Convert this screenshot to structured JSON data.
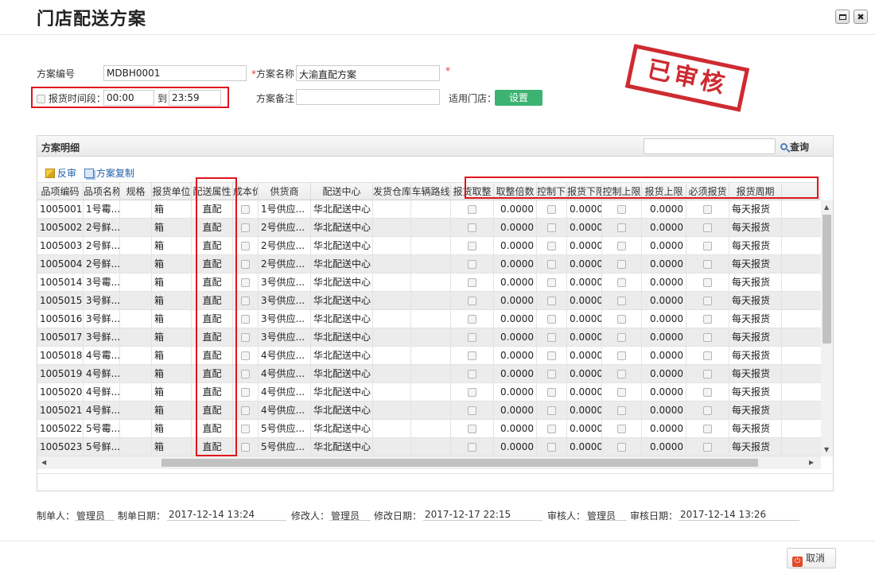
{
  "window": {
    "title": "门店配送方案",
    "max_glyph": "□",
    "close_glyph": "✖"
  },
  "form": {
    "code_label": "方案编号",
    "code_value": "MDBH0001",
    "name_required": "*",
    "name_label": "方案名称",
    "name_value": "大渝直配方案",
    "name_required_tail": "*",
    "time_label": "报货时间段：",
    "time_from": "00:00",
    "time_to_label": "到",
    "time_to": "23:59",
    "remark_label": "方案备注",
    "remark_value": "",
    "store_label": "适用门店：",
    "store_button": "设置"
  },
  "stamp": {
    "text": "已审核"
  },
  "panel": {
    "title": "方案明细",
    "search_value": "",
    "query_label": "查询",
    "toolbar": {
      "reverse_label": "反审",
      "copy_label": "方案复制"
    }
  },
  "columns": [
    "品项编码",
    "品项名称",
    "规格",
    "报货单位",
    "配送属性",
    "成本价",
    "供货商",
    "配送中心",
    "发货仓库",
    "车辆路线",
    "报货取整",
    "取整倍数",
    "控制下限",
    "报货下限",
    "控制上限",
    "报货上限",
    "必须报货",
    "报货周期"
  ],
  "rows": [
    {
      "code": "1005001",
      "name": "1号霉...",
      "spec": "",
      "unit": "箱",
      "attr": "直配",
      "supplier": "1号供应...",
      "center": "华北配送中心",
      "multiple": "0.0000",
      "lower": "0.0000",
      "upper": "0.0000",
      "cycle": "每天报货"
    },
    {
      "code": "1005002",
      "name": "2号鲜...",
      "spec": "",
      "unit": "箱",
      "attr": "直配",
      "supplier": "2号供应...",
      "center": "华北配送中心",
      "multiple": "0.0000",
      "lower": "0.0000",
      "upper": "0.0000",
      "cycle": "每天报货"
    },
    {
      "code": "1005003",
      "name": "2号鲜...",
      "spec": "",
      "unit": "箱",
      "attr": "直配",
      "supplier": "2号供应...",
      "center": "华北配送中心",
      "multiple": "0.0000",
      "lower": "0.0000",
      "upper": "0.0000",
      "cycle": "每天报货"
    },
    {
      "code": "1005004",
      "name": "2号鲜...",
      "spec": "",
      "unit": "箱",
      "attr": "直配",
      "supplier": "2号供应...",
      "center": "华北配送中心",
      "multiple": "0.0000",
      "lower": "0.0000",
      "upper": "0.0000",
      "cycle": "每天报货"
    },
    {
      "code": "1005014",
      "name": "3号霉...",
      "spec": "",
      "unit": "箱",
      "attr": "直配",
      "supplier": "3号供应...",
      "center": "华北配送中心",
      "multiple": "0.0000",
      "lower": "0.0000",
      "upper": "0.0000",
      "cycle": "每天报货"
    },
    {
      "code": "1005015",
      "name": "3号鲜...",
      "spec": "",
      "unit": "箱",
      "attr": "直配",
      "supplier": "3号供应...",
      "center": "华北配送中心",
      "multiple": "0.0000",
      "lower": "0.0000",
      "upper": "0.0000",
      "cycle": "每天报货"
    },
    {
      "code": "1005016",
      "name": "3号鲜...",
      "spec": "",
      "unit": "箱",
      "attr": "直配",
      "supplier": "3号供应...",
      "center": "华北配送中心",
      "multiple": "0.0000",
      "lower": "0.0000",
      "upper": "0.0000",
      "cycle": "每天报货"
    },
    {
      "code": "1005017",
      "name": "3号鲜...",
      "spec": "",
      "unit": "箱",
      "attr": "直配",
      "supplier": "3号供应...",
      "center": "华北配送中心",
      "multiple": "0.0000",
      "lower": "0.0000",
      "upper": "0.0000",
      "cycle": "每天报货"
    },
    {
      "code": "1005018",
      "name": "4号霉...",
      "spec": "",
      "unit": "箱",
      "attr": "直配",
      "supplier": "4号供应...",
      "center": "华北配送中心",
      "multiple": "0.0000",
      "lower": "0.0000",
      "upper": "0.0000",
      "cycle": "每天报货"
    },
    {
      "code": "1005019",
      "name": "4号鲜...",
      "spec": "",
      "unit": "箱",
      "attr": "直配",
      "supplier": "4号供应...",
      "center": "华北配送中心",
      "multiple": "0.0000",
      "lower": "0.0000",
      "upper": "0.0000",
      "cycle": "每天报货"
    },
    {
      "code": "1005020",
      "name": "4号鲜...",
      "spec": "",
      "unit": "箱",
      "attr": "直配",
      "supplier": "4号供应...",
      "center": "华北配送中心",
      "multiple": "0.0000",
      "lower": "0.0000",
      "upper": "0.0000",
      "cycle": "每天报货"
    },
    {
      "code": "1005021",
      "name": "4号鲜...",
      "spec": "",
      "unit": "箱",
      "attr": "直配",
      "supplier": "4号供应...",
      "center": "华北配送中心",
      "multiple": "0.0000",
      "lower": "0.0000",
      "upper": "0.0000",
      "cycle": "每天报货"
    },
    {
      "code": "1005022",
      "name": "5号霉...",
      "spec": "",
      "unit": "箱",
      "attr": "直配",
      "supplier": "5号供应...",
      "center": "华北配送中心",
      "multiple": "0.0000",
      "lower": "0.0000",
      "upper": "0.0000",
      "cycle": "每天报货"
    },
    {
      "code": "1005023",
      "name": "5号鲜...",
      "spec": "",
      "unit": "箱",
      "attr": "直配",
      "supplier": "5号供应...",
      "center": "华北配送中心",
      "multiple": "0.0000",
      "lower": "0.0000",
      "upper": "0.0000",
      "cycle": "每天报货"
    }
  ],
  "footer": {
    "creator_label": "制单人：",
    "creator": "管理员",
    "create_date_label": "制单日期：",
    "create_date": "2017-12-14 13:24",
    "modifier_label": "修改人：",
    "modifier": "管理员",
    "modify_date_label": "修改日期：",
    "modify_date": "2017-12-17 22:15",
    "auditor_label": "审核人：",
    "auditor": "管理员",
    "audit_date_label": "审核日期：",
    "audit_date": "2017-12-14 13:26",
    "cancel_label": "取消"
  },
  "colors": {
    "stamp_red": "#cc2027",
    "highlight_red": "#e0141e",
    "button_green": "#3cb371",
    "link_blue": "#1f5fa8"
  }
}
